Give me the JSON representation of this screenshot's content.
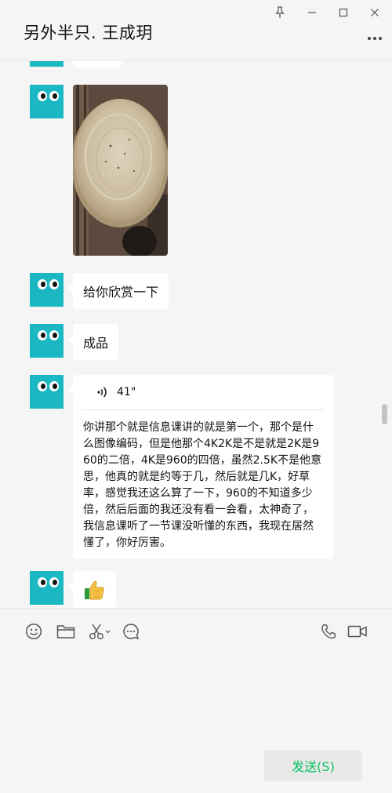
{
  "window": {
    "title": "另外半只. 王成玥",
    "controls": [
      "pin-icon",
      "minimize-icon",
      "maximize-icon",
      "close-icon"
    ],
    "more_icon": "more-dots-icon"
  },
  "messages": [
    {
      "type": "text",
      "sender": "contact",
      "text": ""
    },
    {
      "type": "image",
      "sender": "contact",
      "description_icon": "photo-pancake"
    },
    {
      "type": "text",
      "sender": "contact",
      "text": "给你欣赏一下"
    },
    {
      "type": "text",
      "sender": "contact",
      "text": "成品"
    },
    {
      "type": "voice",
      "sender": "contact",
      "duration": "41\"",
      "transcript": "你讲那个就是信息课讲的就是第一个，那个是什么图像编码，但是他那个4K2K是不是就是2K是960的二倍，4K是960的四倍，虽然2.5K不是他意思，他真的就是约等于几，然后就是几K，好草率，感觉我还这么算了一下，960的不知道多少倍，然后后面的我还没有看一会看，太神奇了，我信息课听了一节课没听懂的东西，我现在居然懂了，你好厉害。"
    },
    {
      "type": "emoji",
      "sender": "contact",
      "emoji": "👍"
    }
  ],
  "toolbar": {
    "left_tools": [
      "emoji-icon",
      "folder-icon",
      "scissors-icon",
      "chat-history-icon"
    ],
    "right_tools": [
      "phone-icon",
      "video-call-icon"
    ]
  },
  "input": {
    "value": ""
  },
  "send_button": {
    "label": "发送(S)"
  },
  "colors": {
    "accent_green": "#07c160",
    "avatar_teal": "#1bb7c3",
    "background": "#f5f5f5"
  }
}
